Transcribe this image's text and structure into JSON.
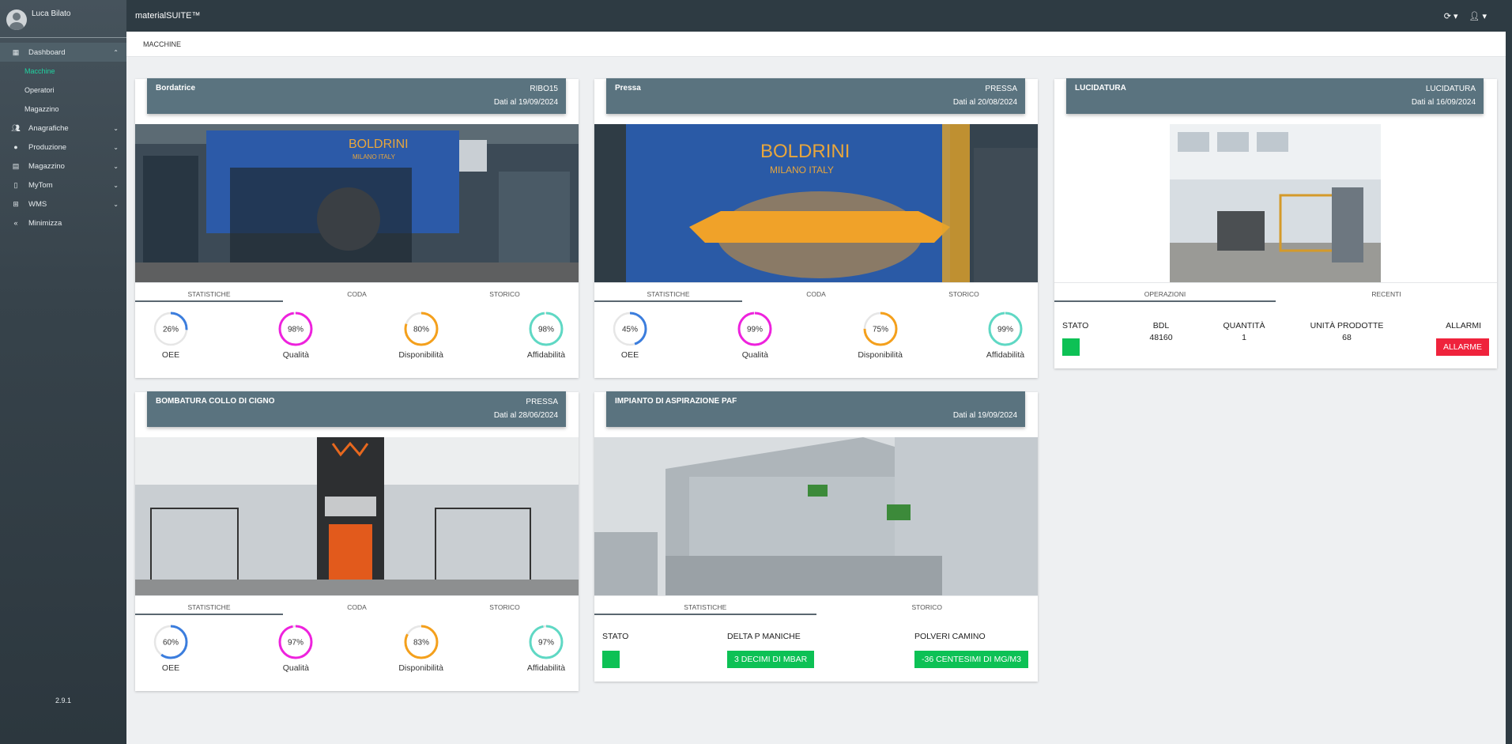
{
  "user": {
    "name": "Luca Bilato"
  },
  "app": {
    "title": "materialSUITE™",
    "version": "2.9.1"
  },
  "topbar": {
    "refresh_caret": "▾",
    "user_caret": "▾"
  },
  "sidebar": {
    "items": [
      {
        "label": "Dashboard",
        "icon": "dashboard-icon"
      },
      {
        "label": "Anagrafiche",
        "icon": "users-icon"
      },
      {
        "label": "Produzione",
        "icon": "fire-icon"
      },
      {
        "label": "Magazzino",
        "icon": "warehouse-icon"
      },
      {
        "label": "MyTom",
        "icon": "mobile-icon"
      },
      {
        "label": "WMS",
        "icon": "sitemap-icon"
      },
      {
        "label": "Minimizza",
        "icon": "double-chevron-left-icon"
      }
    ],
    "subitems": [
      {
        "label": "Macchine"
      },
      {
        "label": "Operatori"
      },
      {
        "label": "Magazzino"
      }
    ]
  },
  "breadcrumb": "MACCHINE",
  "tabs_std": [
    "STATISTICHE",
    "CODA",
    "STORICO"
  ],
  "tabs_luc": [
    "OPERAZIONI",
    "RECENTI"
  ],
  "tabs_asp": [
    "STATISTICHE",
    "STORICO"
  ],
  "gauge_labels": [
    "OEE",
    "Qualità",
    "Disponibilità",
    "Affidabilità"
  ],
  "gauge_colors": [
    "#3b7ddd",
    "#ee22dd",
    "#f4a01c",
    "#5fd8c4"
  ],
  "cards": {
    "bordatrice": {
      "name": "Bordatrice",
      "code": "RIBO15",
      "date": "Dati al 19/09/2024",
      "values": [
        26,
        98,
        80,
        98
      ]
    },
    "pressa": {
      "name": "Pressa",
      "code": "PRESSA",
      "date": "Dati al 20/08/2024",
      "values": [
        45,
        99,
        75,
        99
      ]
    },
    "lucidatura": {
      "name": "LUCIDATURA",
      "code": "LUCIDATURA",
      "date": "Dati al 16/09/2024",
      "stato_label": "STATO",
      "bdl_label": "BDL",
      "bdl_value": "48160",
      "quantita_label": "QUANTITÀ",
      "quantita_value": "1",
      "unita_label": "UNITÀ PRODOTTE",
      "unita_value": "68",
      "allarmi_label": "ALLARMI",
      "allarme_button": "ALLARME"
    },
    "bombatura": {
      "name": "BOMBATURA COLLO DI CIGNO",
      "code": "PRESSA",
      "date": "Dati al 28/06/2024",
      "values": [
        60,
        97,
        83,
        97
      ]
    },
    "aspirazione": {
      "name": "IMPIANTO DI ASPIRAZIONE PAF",
      "date": "Dati al 19/09/2024",
      "stato_label": "STATO",
      "delta_label": "DELTA P MANICHE",
      "delta_value": "3 DECIMI DI MBAR",
      "polveri_label": "POLVERI CAMINO",
      "polveri_value": "-36 CENTESIMI DI MG/M3"
    }
  }
}
